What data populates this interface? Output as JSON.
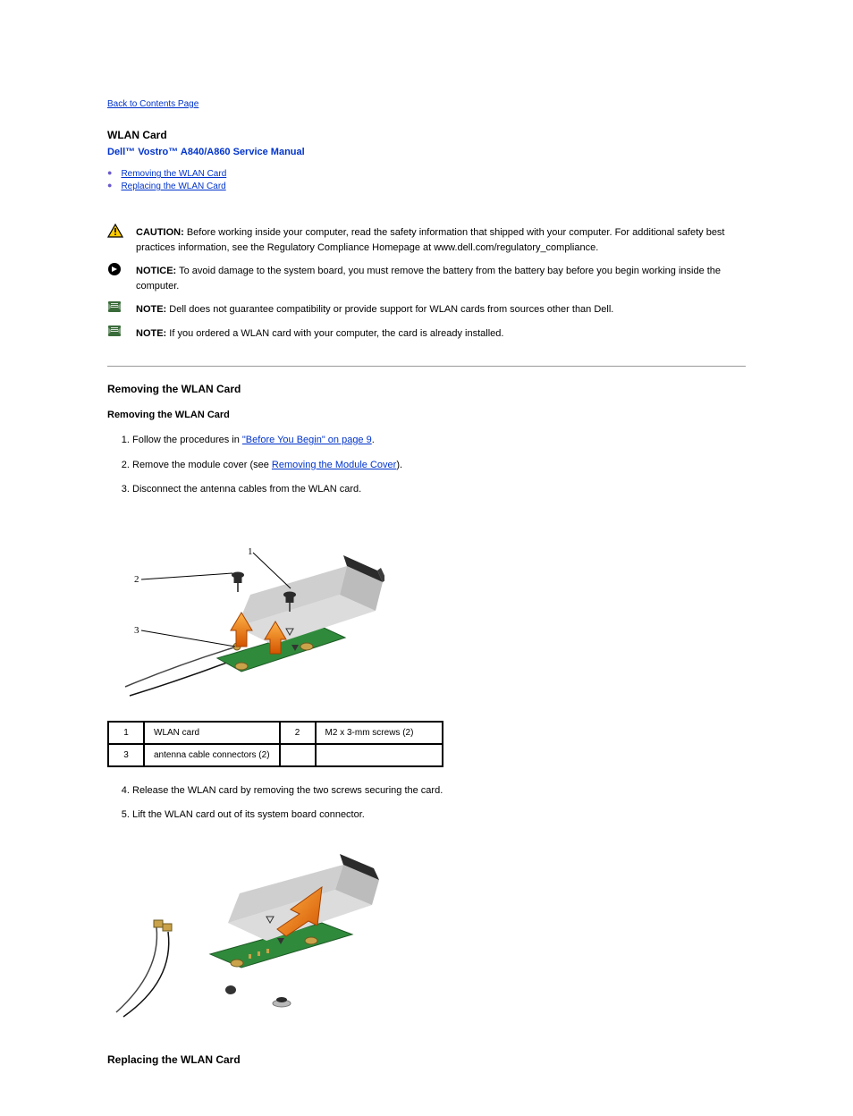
{
  "nav": {
    "back": "Back to Contents Page"
  },
  "heading": {
    "main": "WLAN Card",
    "sub": "Dell™ Vostro™ A840/A860 Service Manual"
  },
  "toc": [
    {
      "label": "Removing the WLAN Card"
    },
    {
      "label": "Replacing the WLAN Card"
    }
  ],
  "callouts": {
    "caution": {
      "label": "CAUTION:",
      "text": " Before working inside your computer, read the safety information that shipped with your computer. For additional safety best practices information, see the Regulatory Compliance Homepage at www.dell.com/regulatory_compliance."
    },
    "notice": {
      "label": "NOTICE:",
      "text": " To avoid damage to the system board, you must remove the battery from the battery bay before you begin working inside the computer."
    },
    "note1": {
      "label": "NOTE:",
      "text": " Dell does not guarantee compatibility or provide support for WLAN cards from sources other than Dell."
    },
    "note2": {
      "label": "NOTE:",
      "text": " If you ordered a WLAN card with your computer, the card is already installed."
    }
  },
  "section": {
    "removing": {
      "title": "Removing the WLAN Card",
      "steps": {
        "s1_pre": "Follow the procedures in ",
        "s1_link": "\"Before You Begin\" on page 9",
        "s1_post": ".",
        "s2_pre": "Remove the module cover (see ",
        "s2_link": "Removing the Module Cover",
        "s2_post": ").",
        "s3": "Disconnect the antenna cables from the WLAN card."
      }
    }
  },
  "parts_table": {
    "r1": {
      "n1": "1",
      "l1": "WLAN card",
      "n2": "2",
      "l2": "M2 x 3-mm screws (2)"
    },
    "r2": {
      "n1": "3",
      "l1": "antenna cable connectors (2)",
      "n2": "",
      "l2": ""
    }
  },
  "more_steps": {
    "s4": "Release the WLAN card by removing the two screws securing the card.",
    "s5": "Lift the WLAN card out of its system board connector."
  },
  "section2": {
    "replacing": {
      "title": "Replacing the WLAN Card"
    }
  }
}
